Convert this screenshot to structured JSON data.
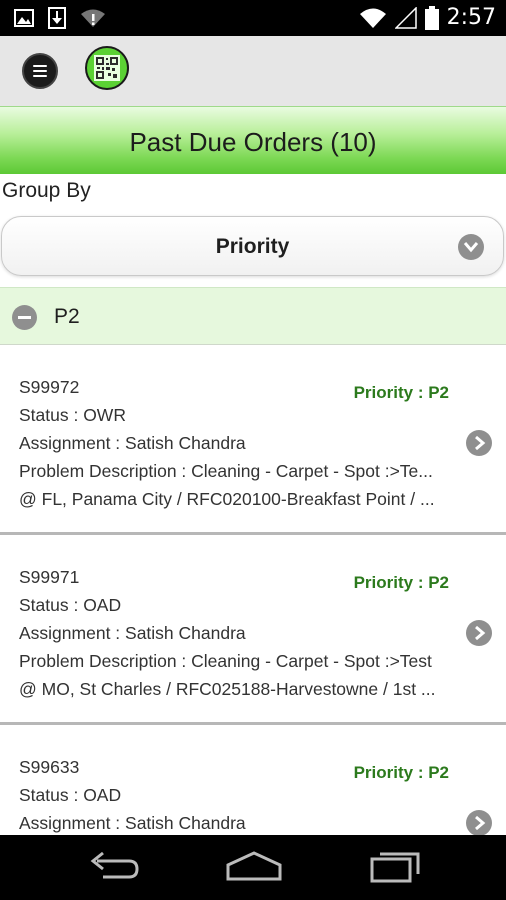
{
  "status_bar": {
    "time": "2:57",
    "left_icons": [
      "image-icon",
      "download-icon",
      "wifi-alert-icon"
    ],
    "right_icons": [
      "wifi-icon",
      "signal-icon",
      "battery-icon"
    ]
  },
  "toolbar": {
    "menu_icon": "menu-icon",
    "qr_icon": "qr-code-icon"
  },
  "header": {
    "title": "Past Due Orders (10)"
  },
  "group_by": {
    "label": "Group By",
    "selected": "Priority"
  },
  "group": {
    "label": "P2"
  },
  "orders": [
    {
      "id": "S99972",
      "status": "Status : OWR",
      "assignment": "Assignment : Satish Chandra",
      "problem": "Problem Description : Cleaning - Carpet - Spot :>Te...",
      "location": "@ FL, Panama City / RFC020100-Breakfast Point / ...",
      "priority": "Priority : P2"
    },
    {
      "id": "S99971",
      "status": "Status : OAD",
      "assignment": "Assignment : Satish Chandra",
      "problem": "Problem Description : Cleaning - Carpet - Spot :>Test",
      "location": "@ MO, St Charles / RFC025188-Harvestowne / 1st ...",
      "priority": "Priority : P2"
    },
    {
      "id": "S99633",
      "status": "Status : OAD",
      "assignment": "Assignment : Satish Chandra",
      "problem": "",
      "location": "",
      "priority": "Priority : P2"
    }
  ],
  "nav": {
    "back": "back-icon",
    "home": "home-icon",
    "recents": "recents-icon"
  },
  "colors": {
    "header_green": "#7fd957",
    "priority_green": "#2c7a1d",
    "group_bg": "#e6f8dd"
  }
}
